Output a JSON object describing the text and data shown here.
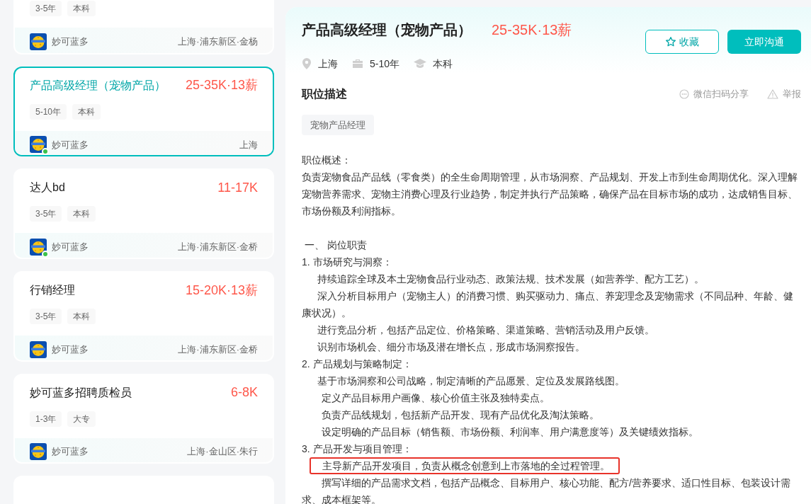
{
  "job_list": [
    {
      "tags": [
        "3-5年",
        "本科"
      ],
      "company": "妙可蓝多",
      "location": "上海·浦东新区·金杨",
      "selected": false,
      "online": false
    },
    {
      "title": "产品高级经理（宠物产品）",
      "salary": "25-35K·13薪",
      "tags": [
        "5-10年",
        "本科"
      ],
      "company": "妙可蓝多",
      "location": "上海",
      "selected": true,
      "online": true
    },
    {
      "title": "达人bd",
      "salary": "11-17K",
      "tags": [
        "3-5年",
        "本科"
      ],
      "company": "妙可蓝多",
      "location": "上海·浦东新区·金桥",
      "selected": false,
      "online": true
    },
    {
      "title": "行销经理",
      "salary": "15-20K·13薪",
      "tags": [
        "3-5年",
        "本科"
      ],
      "company": "妙可蓝多",
      "location": "上海·浦东新区·金桥",
      "selected": false,
      "online": false
    },
    {
      "title": "妙可蓝多招聘质检员",
      "salary": "6-8K",
      "tags": [
        "1-3年",
        "大专"
      ],
      "company": "妙可蓝多",
      "location": "上海·金山区·朱行",
      "selected": false,
      "online": false
    }
  ],
  "detail": {
    "title": "产品高级经理（宠物产品）",
    "salary": "25-35K·13薪",
    "meta": [
      {
        "kind": "location",
        "text": "上海"
      },
      {
        "kind": "experience",
        "text": "5-10年"
      },
      {
        "kind": "degree",
        "text": "本科"
      }
    ],
    "buttons": [
      {
        "kind": "favorite",
        "label": "收藏"
      },
      {
        "kind": "chat",
        "label": "立即沟通"
      }
    ],
    "section_title": "职位描述",
    "share": "微信扫码分享",
    "report": "举报",
    "keywords": [
      "宠物产品经理"
    ],
    "description": [
      {
        "kind": "text",
        "text": "职位概述：",
        "highlighted": false
      },
      {
        "kind": "text",
        "text": "负责宠物食品产品线（零食类）的全生命周期管理，从市场洞察、产品规划、开发上市到生命周期优化。深入理解宠物营养需求、宠物主消费心理及行业趋势，制定并执行产品策略，确保产品在目标市场的成功，达成销售目标、市场份额及利润指标。",
        "highlighted": false
      },
      {
        "kind": "section",
        "text": "一、 岗位职责",
        "highlighted": false
      },
      {
        "kind": "item",
        "text": "1. 市场研究与洞察：",
        "highlighted": false
      },
      {
        "kind": "sub",
        "text": "持续追踪全球及本土宠物食品行业动态、政策法规、技术发展（如营养学、配方工艺）。",
        "highlighted": false
      },
      {
        "kind": "sub",
        "text": "深入分析目标用户（宠物主人）的消费习惯、购买驱动力、痛点、养宠理念及宠物需求（不同品种、年龄、健康状况）。",
        "highlighted": false
      },
      {
        "kind": "sub",
        "text": "进行竞品分析，包括产品定位、价格策略、渠道策略、营销活动及用户反馈。",
        "highlighted": false
      },
      {
        "kind": "sub",
        "text": "识别市场机会、细分市场及潜在增长点，形成市场洞察报告。",
        "highlighted": false
      },
      {
        "kind": "item",
        "text": "2. 产品规划与策略制定：",
        "highlighted": false
      },
      {
        "kind": "sub",
        "text": "基于市场洞察和公司战略，制定清晰的产品愿景、定位及发展路线图。",
        "highlighted": false
      },
      {
        "kind": "sub2",
        "text": "定义产品目标用户画像、核心价值主张及独特卖点。",
        "highlighted": false
      },
      {
        "kind": "sub2",
        "text": "负责产品线规划，包括新产品开发、现有产品优化及淘汰策略。",
        "highlighted": false
      },
      {
        "kind": "sub2",
        "text": "设定明确的产品目标（销售额、市场份额、利润率、用户满意度等）及关键绩效指标。",
        "highlighted": false
      },
      {
        "kind": "item",
        "text": "3. 产品开发与项目管理：",
        "highlighted": false
      },
      {
        "kind": "sub2",
        "text": "主导新产品开发项目，负责从概念创意到上市落地的全过程管理。",
        "highlighted": true
      },
      {
        "kind": "sub2",
        "text": "撰写详细的产品需求文档，包括产品概念、目标用户、核心功能、配方/营养要求、适口性目标、包装设计需求、成本框架等。",
        "highlighted": false
      }
    ]
  }
}
